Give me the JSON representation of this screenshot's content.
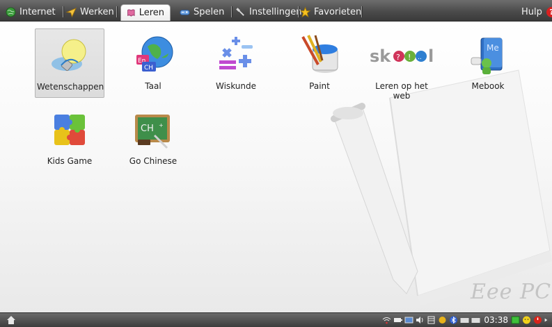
{
  "tabs": [
    {
      "label": "Internet",
      "icon": "globe-icon",
      "active": false
    },
    {
      "label": "Werken",
      "icon": "paper-plane-icon",
      "active": false
    },
    {
      "label": "Leren",
      "icon": "book-icon",
      "active": true
    },
    {
      "label": "Spelen",
      "icon": "game-controller-icon",
      "active": false
    },
    {
      "label": "Instellingen",
      "icon": "wrench-icon",
      "active": false
    },
    {
      "label": "Favorieten",
      "icon": "star-icon",
      "active": false
    }
  ],
  "help": {
    "label": "Hulp",
    "icon": "help-icon"
  },
  "apps": [
    {
      "label": "Wetenschappen",
      "icon": "lightbulb-icon",
      "selected": true
    },
    {
      "label": "Taal",
      "icon": "globe-language-icon",
      "selected": false
    },
    {
      "label": "Wiskunde",
      "icon": "math-symbols-icon",
      "selected": false
    },
    {
      "label": "Paint",
      "icon": "paint-brushes-icon",
      "selected": false
    },
    {
      "label": "Leren op het web",
      "icon": "skoool-logo-icon",
      "logo_text": "skoool",
      "selected": false
    },
    {
      "label": "Mebook",
      "icon": "mebook-icon",
      "selected": false
    },
    {
      "label": "Kids Game",
      "icon": "puzzle-icon",
      "selected": false
    },
    {
      "label": "Go Chinese",
      "icon": "chalkboard-icon",
      "selected": false
    }
  ],
  "watermark": "Eee PC",
  "taskbar": {
    "home_icon": "home-icon",
    "clock": "03:38",
    "tray_icons": [
      "wifi-icon",
      "battery-icon",
      "display-icon",
      "volume-icon",
      "storage-icon",
      "network-icon",
      "bluetooth-icon",
      "keyboard-icon",
      "keyboard-alt-icon",
      "green-app-icon",
      "smiley-icon",
      "power-icon",
      "arrow-right-icon"
    ]
  },
  "colors": {
    "help_badge": "#d92020",
    "taskbar": "#4a4a4a",
    "selection": "#dcdcdc"
  }
}
